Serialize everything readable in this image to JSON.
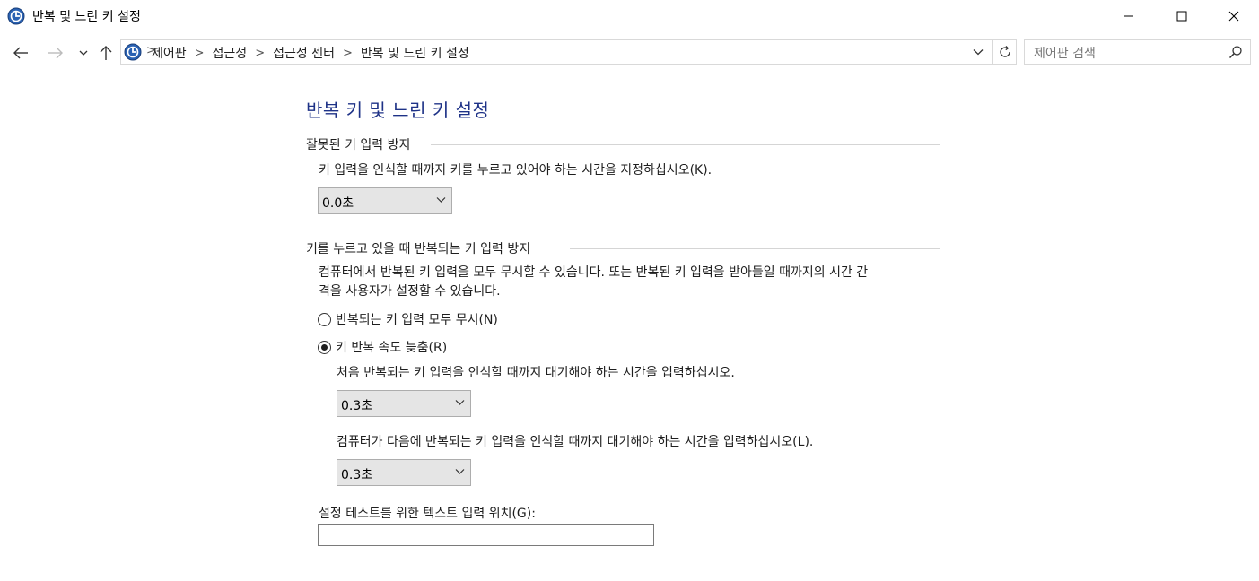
{
  "window": {
    "title": "반복 및 느린 키 설정"
  },
  "address": {
    "crumbs": [
      "제어판",
      "접근성",
      "접근성 센터",
      "반복 및 느린 키 설정"
    ],
    "separator": ">"
  },
  "search": {
    "placeholder": "제어판 검색"
  },
  "page": {
    "title": "반복 키 및 느린 키 설정",
    "group1": {
      "heading": "잘못된 키 입력 방지",
      "description": "키 입력을 인식할 때까지 키를 누르고 있어야 하는 시간을 지정하십시오(K).",
      "select_value": "0.0초"
    },
    "group2": {
      "heading": "키를 누르고 있을 때 반복되는 키 입력 방지",
      "description_line1": "컴퓨터에서 반복된 키 입력을 모두 무시할 수 있습니다. 또는 반복된 키 입력을 받아들일 때까지의 시간 간",
      "description_line2": "격을 사용자가 설정할 수 있습니다.",
      "radio_ignore": "반복되는 키 입력 모두 무시(N)",
      "radio_slow": "키 반복 속도 늦춤(R)",
      "selected_radio": "radio_slow",
      "first_delay_label": "처음 반복되는 키 입력을 인식할 때까지 대기해야 하는 시간을 입력하십시오.",
      "first_delay_value": "0.3초",
      "next_delay_label": "컴퓨터가 다음에 반복되는 키 입력을 인식할 때까지 대기해야 하는 시간을 입력하십시오(L).",
      "next_delay_value": "0.3초"
    },
    "test": {
      "label": "설정 테스트를 위한 텍스트 입력 위치(G):",
      "value": ""
    }
  },
  "colors": {
    "title_blue": "#1e3287",
    "icon_blue": "#2a62b3"
  },
  "icons": {
    "app": "control-panel-icon",
    "back": "arrow-left-icon",
    "forward": "arrow-right-icon",
    "recent": "chevron-down-icon",
    "up": "arrow-up-icon",
    "refresh": "refresh-icon",
    "search": "search-icon"
  }
}
